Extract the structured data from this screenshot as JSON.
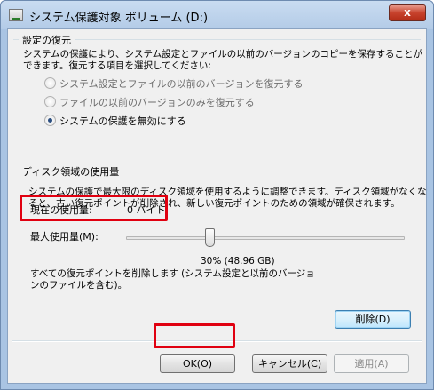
{
  "window": {
    "title": "システム保護対象 ボリューム (D:)",
    "close_label": "x"
  },
  "restore_settings": {
    "group_title": "設定の復元",
    "description_line1": "システムの保護により、システム設定とファイルの以前のバージョンのコピーを保存することが",
    "description_line2": "できます。復元する項目を選択してください:",
    "options": [
      {
        "label": "システム設定とファイルの以前のバージョンを復元する",
        "selected": false,
        "enabled": false
      },
      {
        "label": "ファイルの以前のバージョンのみを復元する",
        "selected": false,
        "enabled": false
      },
      {
        "label": "システムの保護を無効にする",
        "selected": true,
        "enabled": true
      }
    ]
  },
  "disk_usage": {
    "group_title": "ディスク領域の使用量",
    "description_line1": "システムの保護で最大限のディスク領域を使用するように調整できます。ディスク領域がなくな",
    "description_line2": "ると、古い復元ポイントが削除され、新しい復元ポイントのための領域が確保されます。",
    "current_usage_label": "現在の使用量:",
    "current_usage_value": "0 バイト",
    "max_usage_label": "最大使用量(M):",
    "max_usage_percent": 30,
    "max_usage_text": "30% (48.96 GB)",
    "delete_text_line1": "すべての復元ポイントを削除します (システム設定と以前のバージョ",
    "delete_text_line2": "ンのファイルを含む)。",
    "delete_button": "削除(D)"
  },
  "footer": {
    "ok_button": "OK(O)",
    "cancel_button": "キャンセル(C)",
    "apply_button": "適用(A)"
  },
  "colors": {
    "highlight": "#e00010",
    "title_bar": "#b9d1ea",
    "dialog_bg": "#f0f0f0"
  }
}
